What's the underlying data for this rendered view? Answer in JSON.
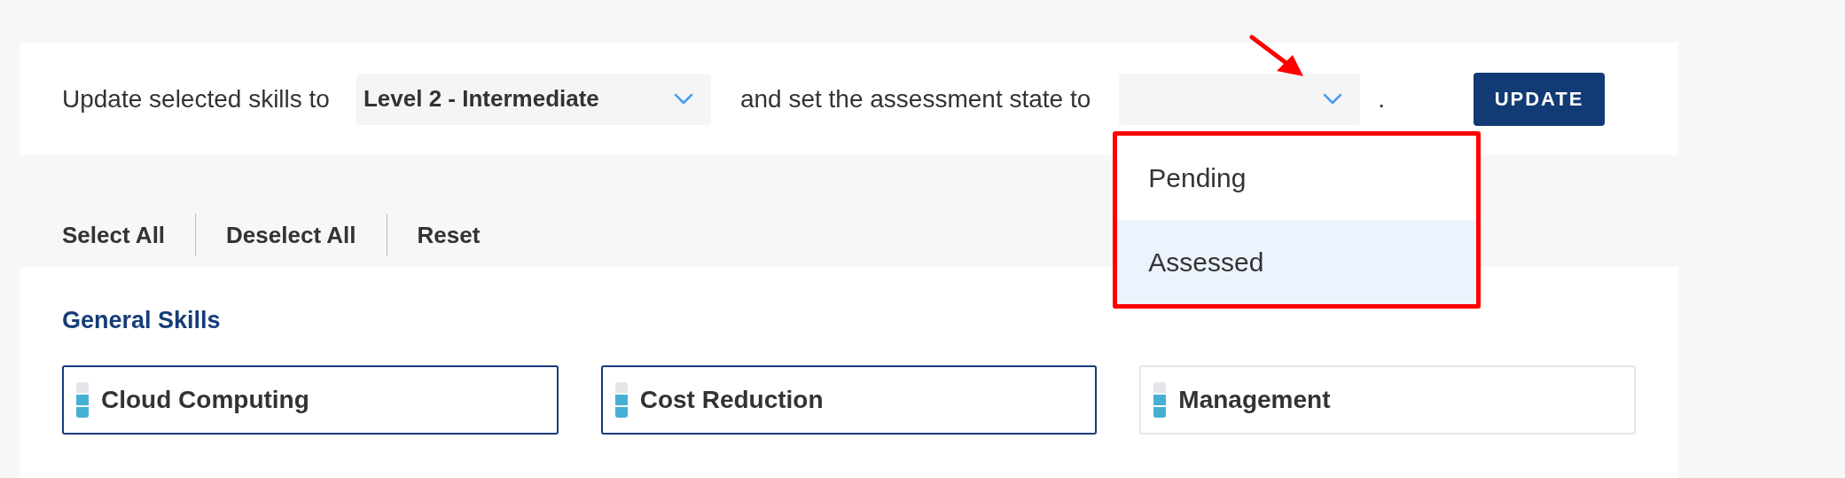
{
  "update_bar": {
    "label_before": "Update selected skills to",
    "level_select": {
      "value": "Level 2 - Intermediate"
    },
    "label_middle": "and set the assessment state to",
    "state_select": {
      "expanded": true,
      "options": [
        {
          "label": "Pending",
          "selected": false
        },
        {
          "label": "Assessed",
          "selected": true
        }
      ]
    },
    "label_after": ".",
    "button": "UPDATE"
  },
  "actions": [
    "Select All",
    "Deselect All",
    "Reset"
  ],
  "section": {
    "title": "General Skills",
    "skills": [
      {
        "name": "Cloud Computing",
        "selected": true,
        "level": 0.67
      },
      {
        "name": "Cost Reduction",
        "selected": true,
        "level": 0.67
      },
      {
        "name": "Management",
        "selected": false,
        "level": 0.67
      }
    ]
  }
}
